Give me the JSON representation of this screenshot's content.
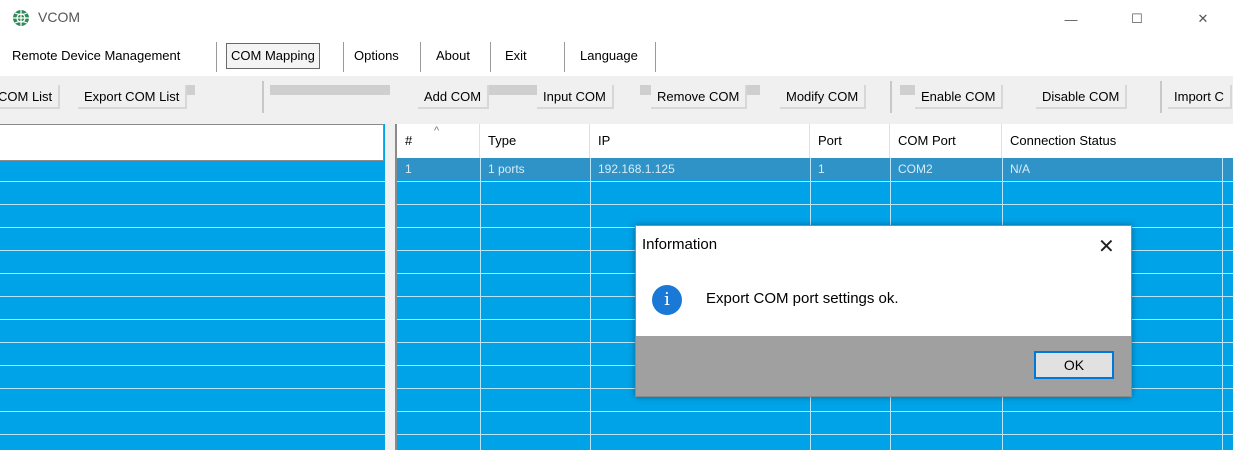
{
  "window": {
    "title": "VCOM",
    "icon": "globe-app-icon",
    "controls": {
      "minimize": "—",
      "maximize": "☐",
      "close": "✕"
    }
  },
  "menu": {
    "items": [
      {
        "label": "Remote Device Management"
      },
      {
        "label": "COM Mapping",
        "active": true
      },
      {
        "label": "Options"
      },
      {
        "label": "About"
      },
      {
        "label": "Exit"
      },
      {
        "label": "Language"
      }
    ]
  },
  "toolbar": {
    "buttons": [
      "COM List",
      "Export COM List",
      "Add COM",
      "Input COM",
      "Remove COM",
      "Modify COM",
      "Enable COM",
      "Disable COM",
      "Import C"
    ]
  },
  "table": {
    "sort_glyph": "^",
    "columns": [
      "#",
      "Type",
      "IP",
      "Port",
      "COM Port",
      "Connection Status"
    ],
    "rows": [
      {
        "num": "1",
        "type": "1 ports",
        "ip": "192.168.1.125",
        "port": "1",
        "com": "COM2",
        "status": "N/A"
      }
    ]
  },
  "dialog": {
    "title": "Information",
    "close": "✕",
    "icon_glyph": "i",
    "message": "Export COM port settings ok.",
    "ok_label": "OK"
  },
  "colors": {
    "grid_background": "#00a2e8",
    "selected_row": "#2f93c8",
    "dialog_footer": "#a0a0a0",
    "info_icon": "#1a78d6",
    "ok_focus_border": "#0078d7"
  }
}
